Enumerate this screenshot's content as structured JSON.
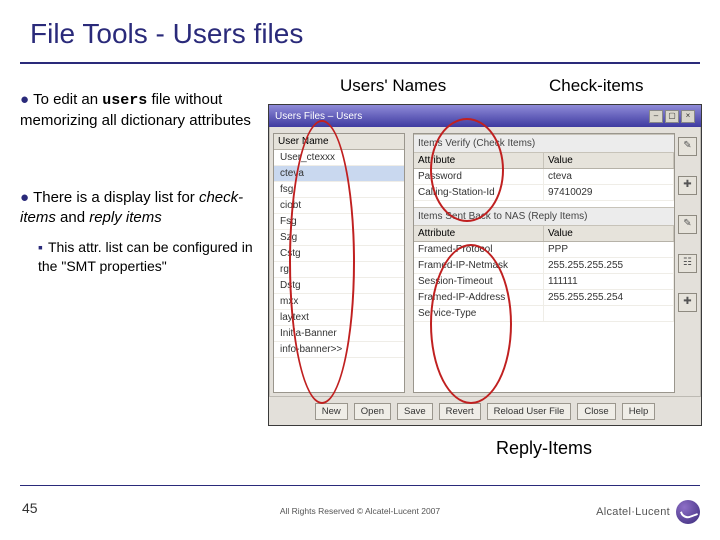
{
  "title": "File Tools - Users files",
  "bullets": {
    "b1_pre": "To edit an ",
    "b1_code": "users",
    "b1_post": " file without memorizing all dictionary attributes",
    "b2_pre": "There is a display list for ",
    "b2_em1": "check-items",
    "b2_mid": " and ",
    "b2_em2": "reply items",
    "sub": "This attr. list can be configured in the \"SMT properties\""
  },
  "callouts": {
    "users": "Users' Names",
    "check": "Check-items",
    "reply": "Reply-Items"
  },
  "window": {
    "title": "Users Files – Users",
    "left_header": "User Name",
    "users": [
      "User_ctexxx",
      "cteva",
      "fsg",
      "ciobt",
      "Fsg",
      "Szg",
      "Cstg",
      "rg",
      "Dstg",
      "mxx",
      "laytext",
      "Initia-Banner",
      "info-banner>>"
    ],
    "check": {
      "section": "Items Verify (Check Items)",
      "col1": "Attribute",
      "col2": "Value",
      "rows": [
        {
          "a": "Password",
          "v": "cteva"
        },
        {
          "a": "Calling-Station-Id",
          "v": "97410029"
        }
      ]
    },
    "reply": {
      "section": "Items Sent Back to NAS (Reply Items)",
      "col1": "Attribute",
      "col2": "Value",
      "rows": [
        {
          "a": "Framed-Protocol",
          "v": "PPP"
        },
        {
          "a": "Framed-IP-Netmask",
          "v": "255.255.255.255"
        },
        {
          "a": "Session-Timeout",
          "v": "111111"
        },
        {
          "a": "Framed-IP-Address",
          "v": "255.255.255.254"
        },
        {
          "a": "Service-Type",
          "v": ""
        }
      ]
    },
    "buttons": [
      "New",
      "Open",
      "Save",
      "Revert",
      "Reload User File",
      "Close",
      "Help"
    ]
  },
  "footer": {
    "page": "45",
    "copyright": "All Rights Reserved © Alcatel-Lucent 2007",
    "brand": "Alcatel·Lucent"
  }
}
